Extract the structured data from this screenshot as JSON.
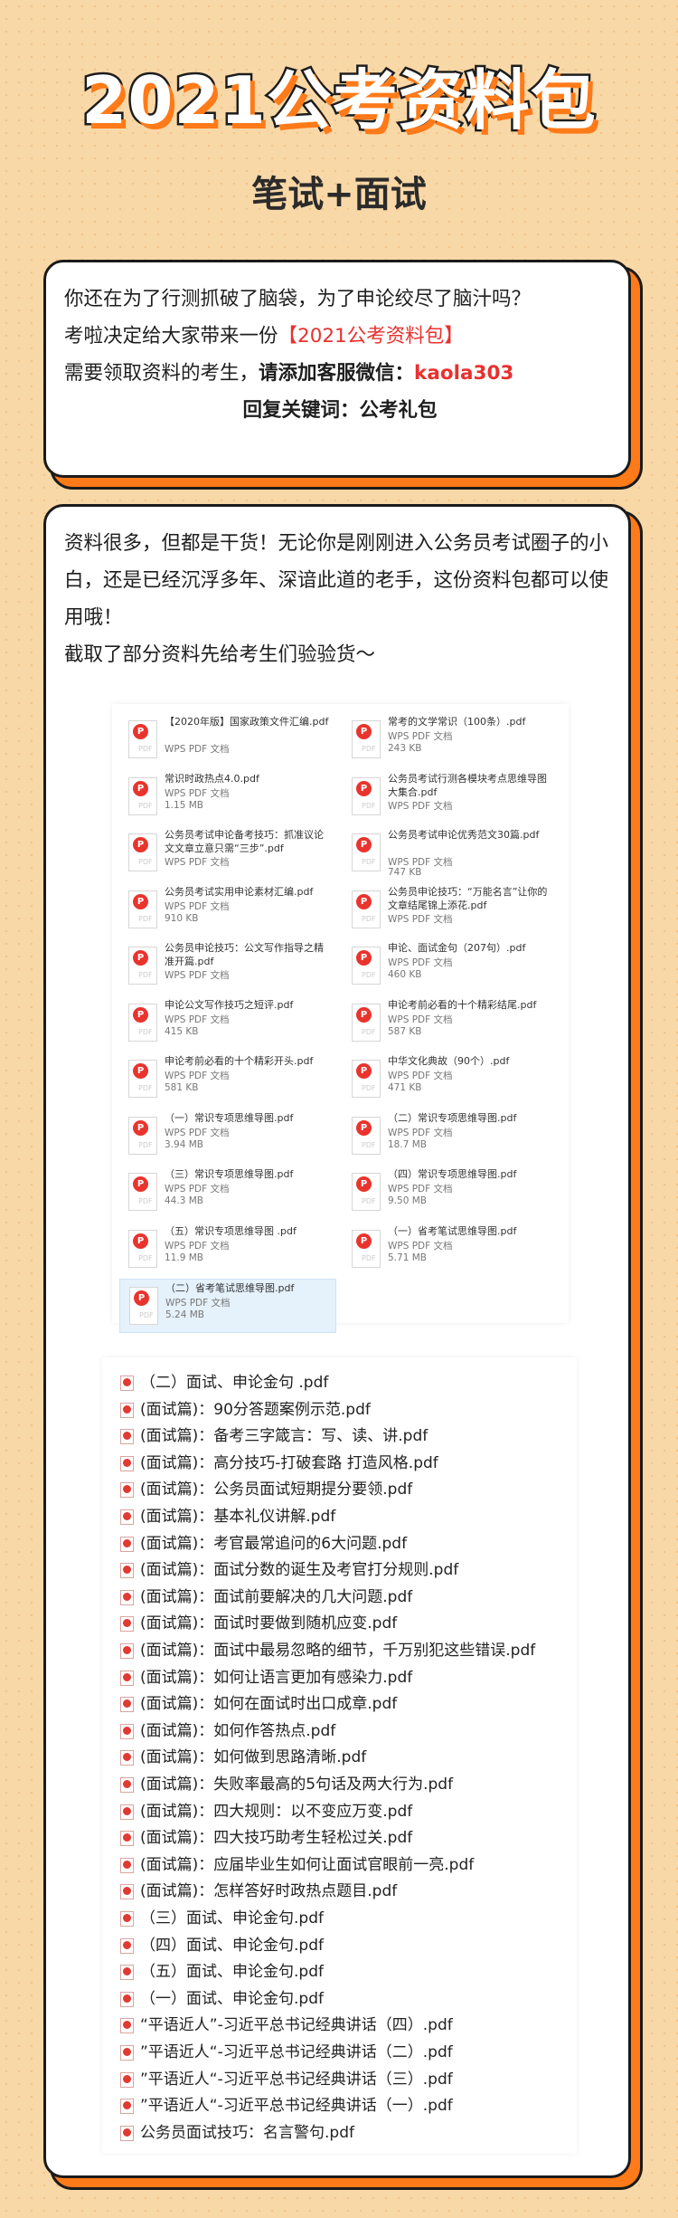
{
  "header": {
    "title": "2021公考资料包",
    "subtitle": "笔试+面试"
  },
  "card1": {
    "line1": "你还在为了行测抓破了脑袋，为了申论绞尽了脑汁吗？",
    "line2_a": "考啦决定给大家带来一份",
    "line2_b": "【2021公考资料包】",
    "line3_a": "需要领取资料的考生，",
    "line3_b": "请添加客服微信：",
    "line3_c": "kaola303",
    "line4": "回复关键词：公考礼包"
  },
  "card2": {
    "para1": "资料很多，但都是干货！无论你是刚刚进入公务员考试圈子的小白，还是已经沉浮多年、深谙此道的老手，这份资料包都可以使用哦！",
    "para2": "截取了部分资料先给考生们验验货～"
  },
  "icon_labels": {
    "pdf_mark": "P",
    "pdf_tag": "PDF"
  },
  "grid_files": [
    {
      "name": "【2020年版】国家政策文件汇编.pdf",
      "type": "WPS PDF 文档",
      "size": ""
    },
    {
      "name": "常考的文学常识（100条）.pdf",
      "type": "WPS PDF 文档",
      "size": "243 KB"
    },
    {
      "name": "常识时政热点4.0.pdf",
      "type": "WPS PDF 文档",
      "size": "1.15 MB"
    },
    {
      "name": "公务员考试行测各模块考点思维导图大集合.pdf",
      "type": "WPS PDF 文档",
      "size": ""
    },
    {
      "name": "公务员考试申论备考技巧：抓准议论文文章立意只需“三步”.pdf",
      "type": "WPS PDF 文档",
      "size": ""
    },
    {
      "name": "公务员考试申论优秀范文30篇.pdf",
      "type": "WPS PDF 文档",
      "size": "747 KB"
    },
    {
      "name": "公务员考试实用申论素材汇编.pdf",
      "type": "WPS PDF 文档",
      "size": "910 KB"
    },
    {
      "name": "公务员申论技巧：“万能名言”让你的文章结尾锦上添花.pdf",
      "type": "WPS PDF 文档",
      "size": ""
    },
    {
      "name": "公务员申论技巧：公文写作指导之精准开篇.pdf",
      "type": "WPS PDF 文档",
      "size": ""
    },
    {
      "name": "申论、面试金句（207句）.pdf",
      "type": "WPS PDF 文档",
      "size": "460 KB"
    },
    {
      "name": "申论公文写作技巧之短评.pdf",
      "type": "WPS PDF 文档",
      "size": "415 KB"
    },
    {
      "name": "申论考前必看的十个精彩结尾.pdf",
      "type": "WPS PDF 文档",
      "size": "587 KB"
    },
    {
      "name": "申论考前必看的十个精彩开头.pdf",
      "type": "WPS PDF 文档",
      "size": "581 KB"
    },
    {
      "name": "中华文化典故（90个）.pdf",
      "type": "WPS PDF 文档",
      "size": "471 KB"
    },
    {
      "name": "（一）常识专项思维导图.pdf",
      "type": "WPS PDF 文档",
      "size": "3.94 MB"
    },
    {
      "name": "（二）常识专项思维导图.pdf",
      "type": "WPS PDF 文档",
      "size": "18.7 MB"
    },
    {
      "name": "（三）常识专项思维导图.pdf",
      "type": "WPS PDF 文档",
      "size": "44.3 MB"
    },
    {
      "name": "（四）常识专项思维导图.pdf",
      "type": "WPS PDF 文档",
      "size": "9.50 MB"
    },
    {
      "name": "（五）常识专项思维导图 .pdf",
      "type": "WPS PDF 文档",
      "size": "11.9 MB"
    },
    {
      "name": "（一）省考笔试思维导图.pdf",
      "type": "WPS PDF 文档",
      "size": "5.71 MB"
    },
    {
      "name": "（二）省考笔试思维导图.pdf",
      "type": "WPS PDF 文档",
      "size": "5.24 MB"
    }
  ],
  "list_files": [
    "（二）面试、申论金句 .pdf",
    "(面试篇)：90分答题案例示范.pdf",
    "(面试篇)：备考三字箴言：写、读、讲.pdf",
    "(面试篇)：高分技巧-打破套路 打造风格.pdf",
    "(面试篇)：公务员面试短期提分要领.pdf",
    "(面试篇)：基本礼仪讲解.pdf",
    "(面试篇)：考官最常追问的6大问题.pdf",
    "(面试篇)：面试分数的诞生及考官打分规则.pdf",
    "(面试篇)：面试前要解决的几大问题.pdf",
    "(面试篇)：面试时要做到随机应变.pdf",
    "(面试篇)：面试中最易忽略的细节，千万别犯这些错误.pdf",
    "(面试篇)：如何让语言更加有感染力.pdf",
    "(面试篇)：如何在面试时出口成章.pdf",
    "(面试篇)：如何作答热点.pdf",
    "(面试篇)：如何做到思路清晰.pdf",
    "(面试篇)：失败率最高的5句话及两大行为.pdf",
    "(面试篇)：四大规则：以不变应万变.pdf",
    "(面试篇)：四大技巧助考生轻松过关.pdf",
    "(面试篇)：应届毕业生如何让面试官眼前一亮.pdf",
    "(面试篇)：怎样答好时政热点题目.pdf",
    "（三）面试、申论金句.pdf",
    "（四）面试、申论金句.pdf",
    "（五）面试、申论金句.pdf",
    "（一）面试、申论金句.pdf",
    "“平语近人”-习近平总书记经典讲话（四）.pdf",
    "”平语近人“-习近平总书记经典讲话（二）.pdf",
    "”平语近人“-习近平总书记经典讲话（三）.pdf",
    "”平语近人“-习近平总书记经典讲话（一）.pdf",
    "公务员面试技巧：名言警句.pdf"
  ]
}
